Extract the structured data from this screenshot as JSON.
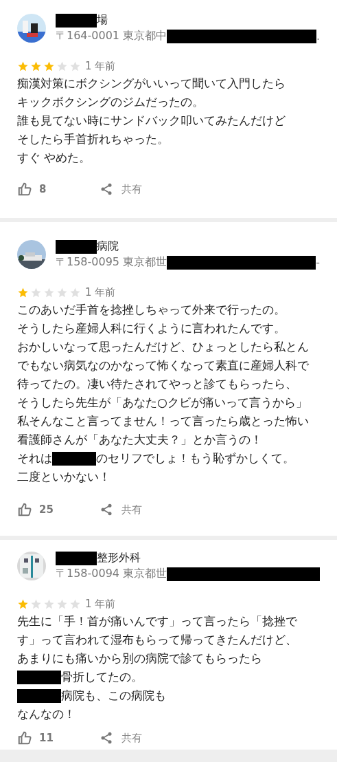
{
  "reviews": [
    {
      "name": [
        {
          "kind": "redacted"
        },
        {
          "kind": "text",
          "text": "場"
        }
      ],
      "address": [
        {
          "kind": "text",
          "text": "〒164-0001 東京都中"
        },
        {
          "kind": "redacted"
        },
        {
          "kind": "text",
          "text": "."
        }
      ],
      "stars": 3,
      "time": "1 年前",
      "body": [
        [
          {
            "kind": "text",
            "text": "痴漢対策にボクシングがいいって聞いて入門したら"
          }
        ],
        [
          {
            "kind": "text",
            "text": "キックボクシングのジムだったの。"
          }
        ],
        [
          {
            "kind": "text",
            "text": "誰も見てない時にサンドバック叩いてみたんだけど"
          }
        ],
        [
          {
            "kind": "text",
            "text": "そしたら手首折れちゃった。"
          }
        ],
        [
          {
            "kind": "text",
            "text": "すぐ やめた。"
          }
        ]
      ],
      "likes": "8",
      "share": "共有"
    },
    {
      "name": [
        {
          "kind": "redacted"
        },
        {
          "kind": "text",
          "text": "病院"
        }
      ],
      "address": [
        {
          "kind": "text",
          "text": "〒158-0095 東京都世"
        },
        {
          "kind": "redacted"
        },
        {
          "kind": "text",
          "text": "-"
        }
      ],
      "stars": 1,
      "time": "1 年前",
      "body": [
        [
          {
            "kind": "text",
            "text": "このあいだ手首を捻挫しちゃって外来で行ったの。"
          }
        ],
        [
          {
            "kind": "text",
            "text": "そうしたら産婦人科に行くように言われたんです。"
          }
        ],
        [
          {
            "kind": "text",
            "text": "おかしいなって思ったんだけど、ひょっとしたら私とん"
          }
        ],
        [
          {
            "kind": "text",
            "text": "でもない病気なのかなって怖くなって素直に産婦人科で"
          }
        ],
        [
          {
            "kind": "text",
            "text": "待ってたの。凄い待たされてやっと診てもらったら、"
          }
        ],
        [
          {
            "kind": "text",
            "text": "そうしたら先生が「あなた○クビが痛いって言うから」"
          }
        ],
        [
          {
            "kind": "text",
            "text": "私そんなこと言ってません！って言ったら歳とった怖い"
          }
        ],
        [
          {
            "kind": "text",
            "text": "看護師さんが「あなた大丈夫？」とか言うの！"
          }
        ],
        [
          {
            "kind": "text",
            "text": "それは"
          },
          {
            "kind": "redacted"
          },
          {
            "kind": "text",
            "text": "のセリフでしょ！もう恥ずかしくて。"
          }
        ],
        [
          {
            "kind": "text",
            "text": "二度といかない！"
          }
        ]
      ],
      "likes": "25",
      "share": "共有"
    },
    {
      "name": [
        {
          "kind": "redacted"
        },
        {
          "kind": "text",
          "text": "整形外科"
        }
      ],
      "address": [
        {
          "kind": "text",
          "text": "〒158-0094 東京都世"
        },
        {
          "kind": "redacted"
        }
      ],
      "stars": 1,
      "time": "1 年前",
      "body": [
        [
          {
            "kind": "text",
            "text": "先生に「手！首が痛いんです」って言ったら「捻挫で"
          }
        ],
        [
          {
            "kind": "text",
            "text": "す」って言われて湿布もらって帰ってきたんだけど、"
          }
        ],
        [
          {
            "kind": "text",
            "text": "あまりにも痛いから別の病院で診てもらったら"
          }
        ],
        [
          {
            "kind": "redacted"
          },
          {
            "kind": "text",
            "text": "骨折してたの。"
          }
        ],
        [
          {
            "kind": "redacted"
          },
          {
            "kind": "text",
            "text": "病院も、この病院も"
          }
        ],
        [
          {
            "kind": "text",
            "text": "なんなの！"
          }
        ]
      ],
      "likes": "11",
      "share": "共有"
    }
  ]
}
